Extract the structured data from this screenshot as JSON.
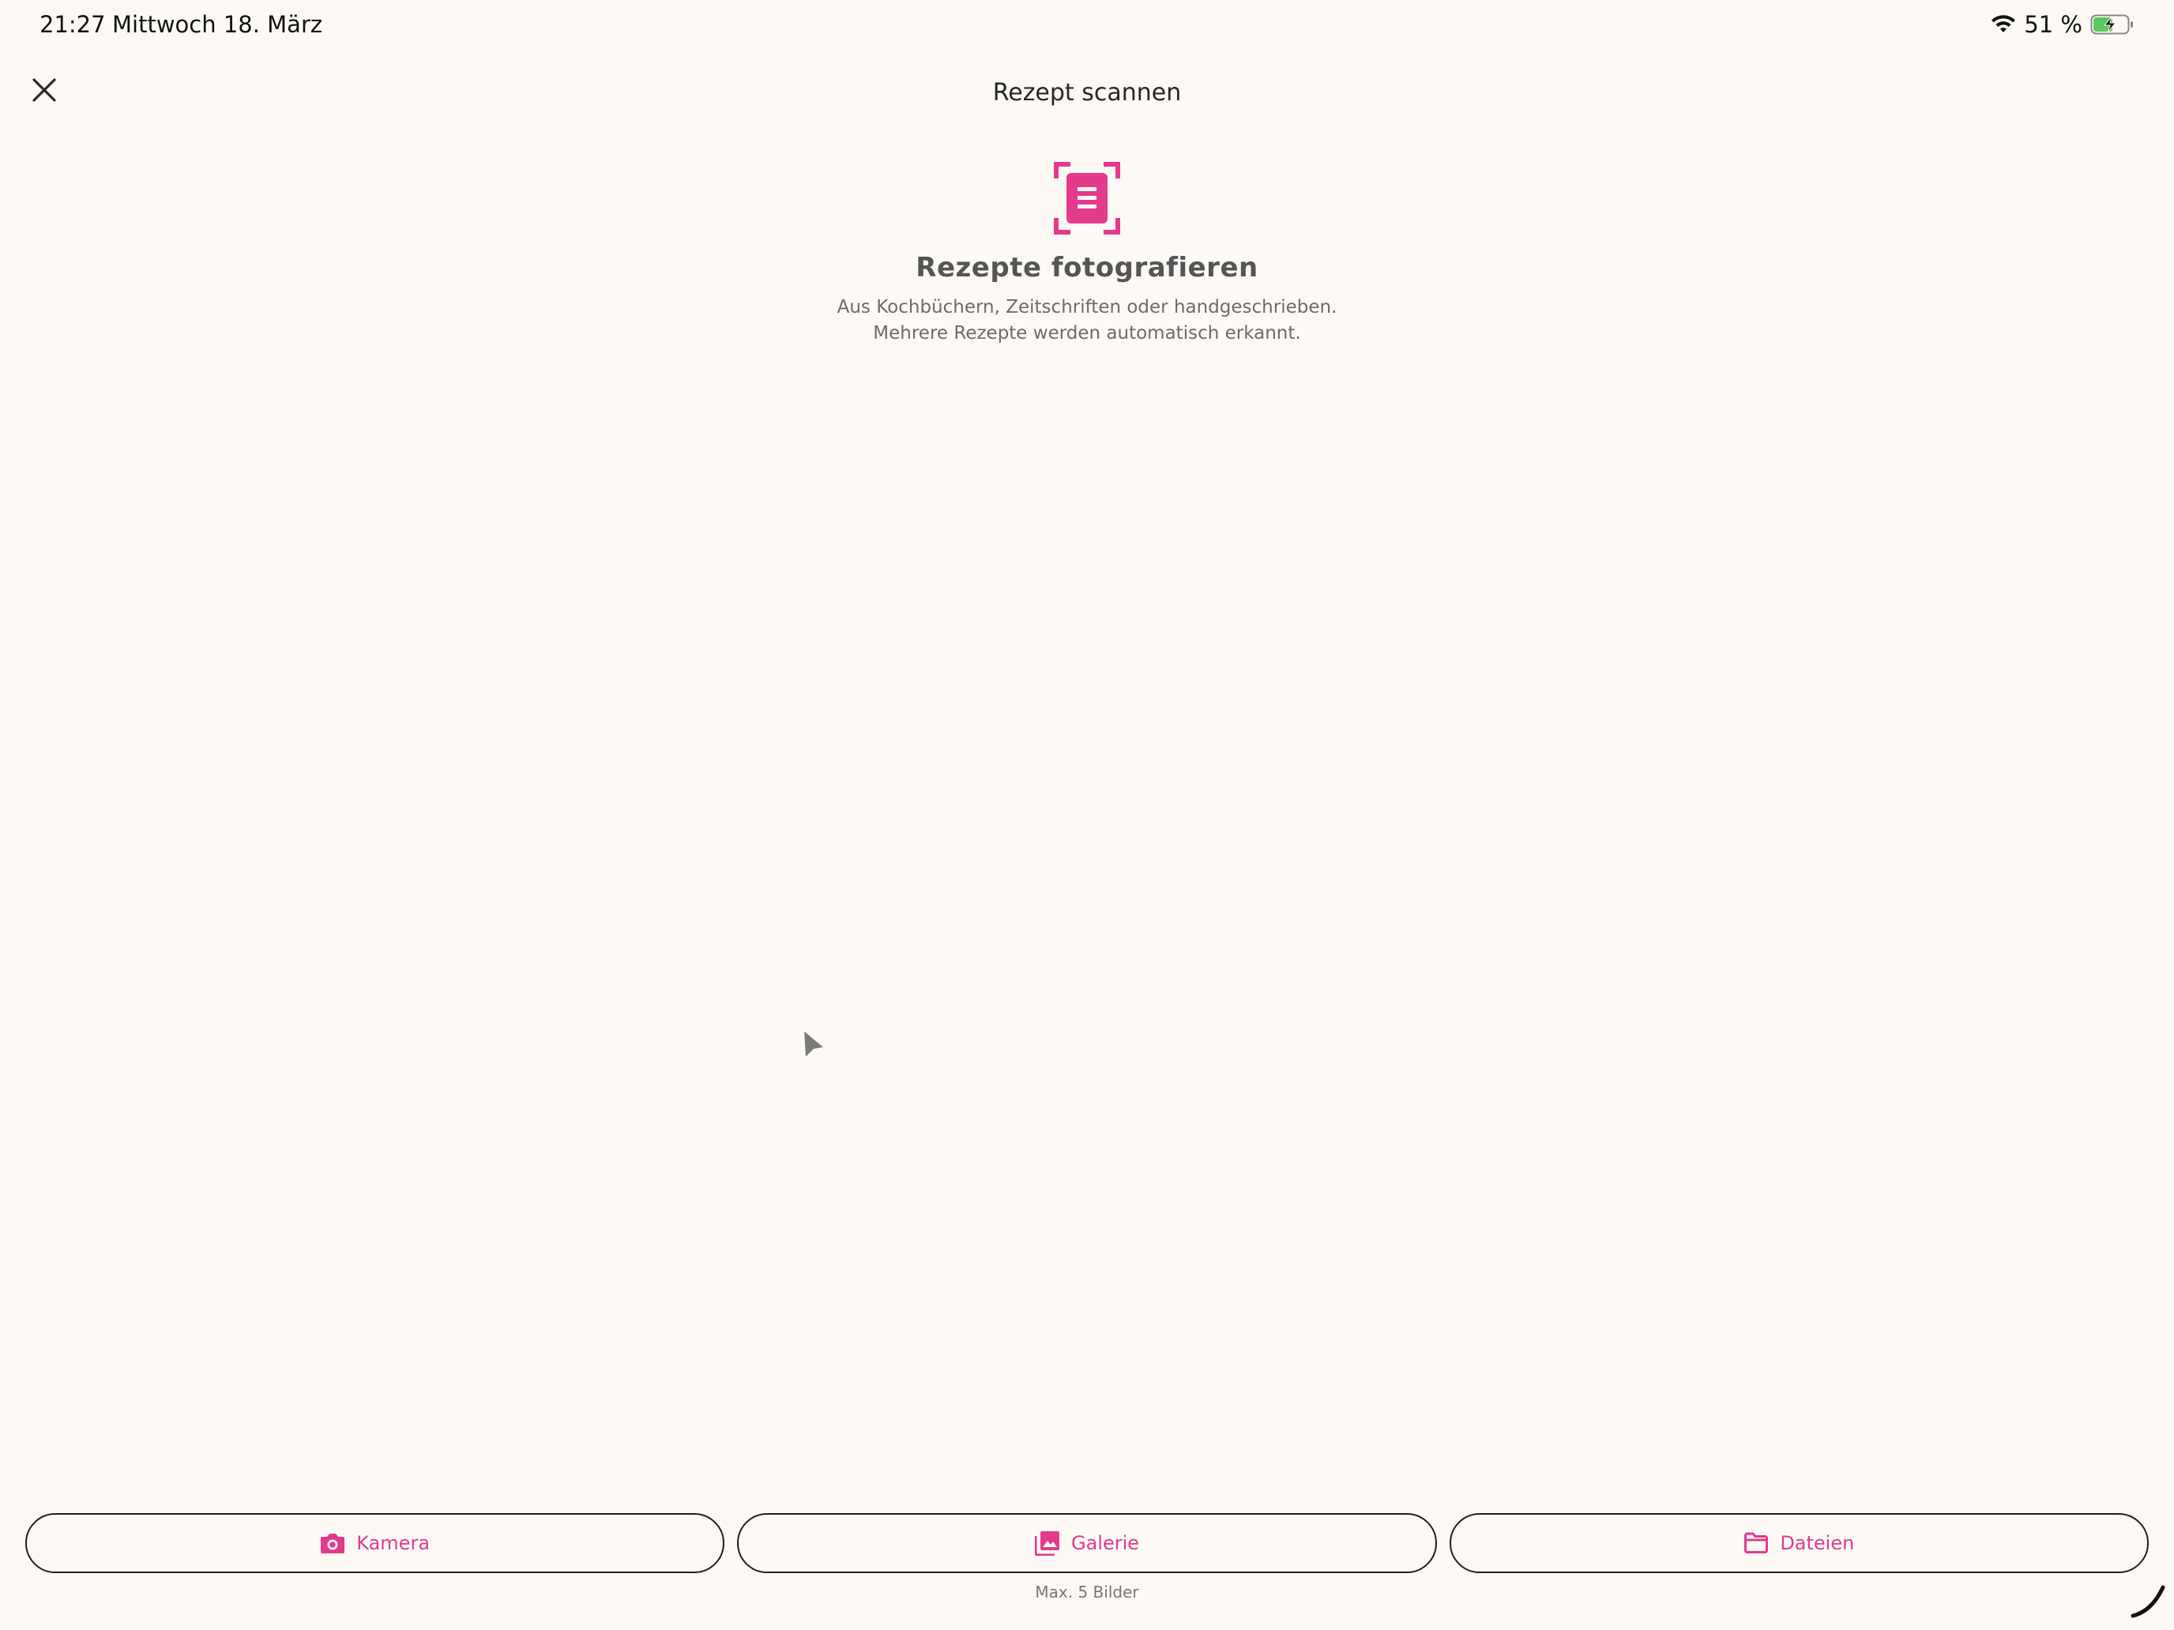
{
  "status_bar": {
    "time": "21:27",
    "date": "Mittwoch 18. März",
    "battery": "51 %"
  },
  "header": {
    "title": "Rezept scannen",
    "close_icon": "close-icon"
  },
  "intro": {
    "icon": "document-scan-icon",
    "heading": "Rezepte fotografieren",
    "line1": "Aus Kochbüchern, Zeitschriften oder handgeschrieben.",
    "line2": "Mehrere Rezepte werden automatisch erkannt."
  },
  "actions": {
    "camera": {
      "label": "Kamera",
      "icon": "camera-icon"
    },
    "gallery": {
      "label": "Galerie",
      "icon": "gallery-icon"
    },
    "files": {
      "label": "Dateien",
      "icon": "folder-icon"
    },
    "limit_note": "Max. 5 Bilder"
  },
  "colors": {
    "accent": "#e43a8c",
    "background": "#fdfaf6",
    "battery_fill": "#5ac85a"
  }
}
